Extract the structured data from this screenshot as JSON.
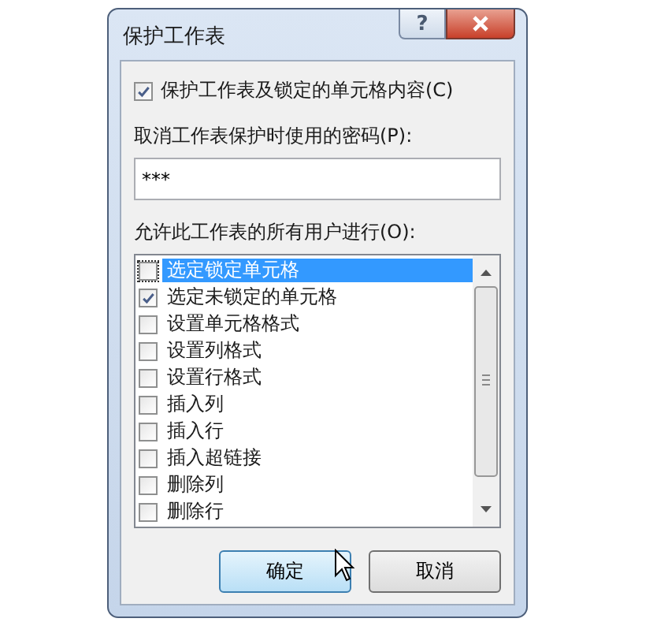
{
  "window": {
    "title": "保护工作表",
    "help": "?"
  },
  "protect_checkbox": {
    "label": "保护工作表及锁定的单元格内容(C)",
    "checked": true
  },
  "password": {
    "label": "取消工作表保护时使用的密码(P):",
    "value": "***"
  },
  "permissions": {
    "label": "允许此工作表的所有用户进行(O):",
    "items": [
      {
        "label": "选定锁定单元格",
        "checked": false,
        "selected": true
      },
      {
        "label": "选定未锁定的单元格",
        "checked": true,
        "selected": false
      },
      {
        "label": "设置单元格格式",
        "checked": false,
        "selected": false
      },
      {
        "label": "设置列格式",
        "checked": false,
        "selected": false
      },
      {
        "label": "设置行格式",
        "checked": false,
        "selected": false
      },
      {
        "label": "插入列",
        "checked": false,
        "selected": false
      },
      {
        "label": "插入行",
        "checked": false,
        "selected": false
      },
      {
        "label": "插入超链接",
        "checked": false,
        "selected": false
      },
      {
        "label": "删除列",
        "checked": false,
        "selected": false
      },
      {
        "label": "删除行",
        "checked": false,
        "selected": false
      }
    ]
  },
  "buttons": [
    {
      "label": "确定",
      "kind": "primary"
    },
    {
      "label": "取消",
      "kind": "normal"
    }
  ]
}
